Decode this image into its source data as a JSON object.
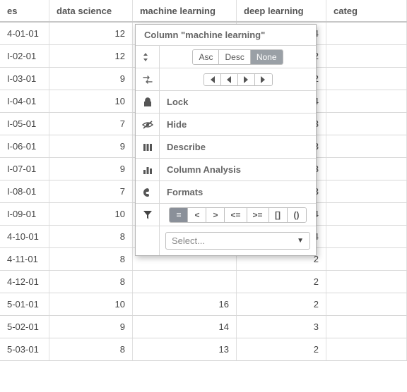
{
  "columns": {
    "es_header": "es",
    "ds_header": "data science",
    "ml_header": "machine learning",
    "dl_header": "deep learning",
    "cat_header": "categ"
  },
  "rows": [
    {
      "es": "4-01-01",
      "ds": 12,
      "ml": "",
      "dl": 4
    },
    {
      "es": "I-02-01",
      "ds": 12,
      "ml": "",
      "dl": 2
    },
    {
      "es": "I-03-01",
      "ds": 9,
      "ml": "",
      "dl": 2
    },
    {
      "es": "I-04-01",
      "ds": 10,
      "ml": "",
      "dl": 4
    },
    {
      "es": "I-05-01",
      "ds": 7,
      "ml": "",
      "dl": 3
    },
    {
      "es": "I-06-01",
      "ds": 9,
      "ml": "",
      "dl": 3
    },
    {
      "es": "I-07-01",
      "ds": 9,
      "ml": "",
      "dl": 3
    },
    {
      "es": "I-08-01",
      "ds": 7,
      "ml": "",
      "dl": 3
    },
    {
      "es": "I-09-01",
      "ds": 10,
      "ml": "",
      "dl": 4
    },
    {
      "es": "4-10-01",
      "ds": 8,
      "ml": "",
      "dl": 4
    },
    {
      "es": "4-11-01",
      "ds": 8,
      "ml": "",
      "dl": 2
    },
    {
      "es": "4-12-01",
      "ds": 8,
      "ml": "",
      "dl": 2
    },
    {
      "es": "5-01-01",
      "ds": 10,
      "ml": 16,
      "dl": 2
    },
    {
      "es": "5-02-01",
      "ds": 9,
      "ml": 14,
      "dl": 3
    },
    {
      "es": "5-03-01",
      "ds": 8,
      "ml": 13,
      "dl": 2
    }
  ],
  "menu": {
    "title": "Column \"machine learning\"",
    "sort": {
      "asc": "Asc",
      "desc": "Desc",
      "none": "None",
      "active": "none"
    },
    "lock": "Lock",
    "hide": "Hide",
    "describe": "Describe",
    "analysis": "Column Analysis",
    "formats": "Formats",
    "filter_ops": {
      "eq": "=",
      "lt": "<",
      "gt": ">",
      "le": "<=",
      "ge": ">=",
      "in": "[]",
      "paren": "()",
      "active": "eq"
    },
    "select_placeholder": "Select..."
  }
}
